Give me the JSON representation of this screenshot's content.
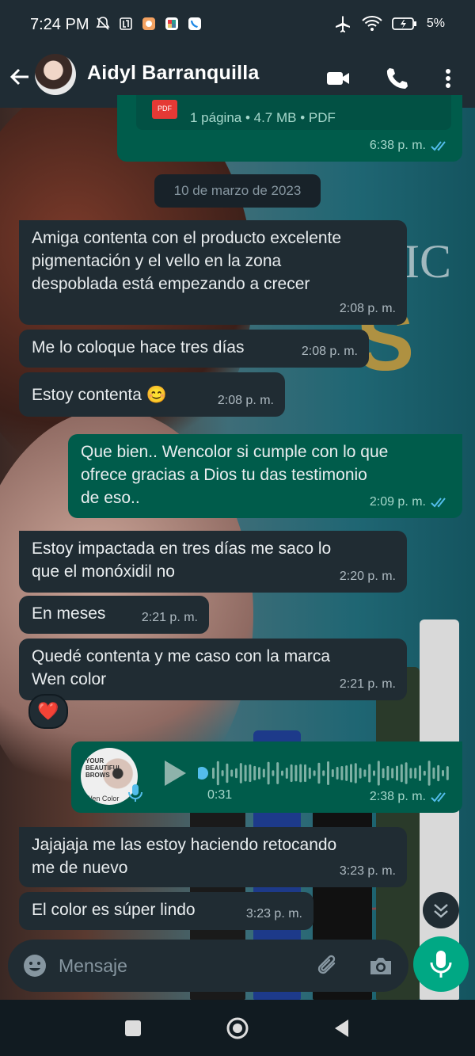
{
  "status_bar": {
    "time": "7:24 PM",
    "battery": "5%"
  },
  "header": {
    "contact_name": "Aidyl Barranquilla"
  },
  "pdf_message": {
    "info": "1 página • 4.7 MB • PDF",
    "time": "6:38 p. m."
  },
  "date_chip": "10 de marzo de 2023",
  "messages": [
    {
      "lines": [
        "Amiga contenta con el producto excelente",
        "pigmentación y el vello en la zona",
        "despoblada está empezando a crecer"
      ],
      "time": "2:08 p. m."
    },
    {
      "lines": [
        "Me lo coloque hace tres días"
      ],
      "time": "2:08 p. m."
    },
    {
      "lines": [
        "Estoy contenta 😊"
      ],
      "time": "2:08 p. m."
    },
    {
      "lines": [
        "Que bien.. Wencolor si cumple con lo que",
        "ofrece gracias a Dios tu das testimonio",
        "de eso.."
      ],
      "time": "2:09 p. m."
    },
    {
      "lines": [
        "Estoy impactada en tres días me saco lo",
        "que el monóxidil no"
      ],
      "time": "2:20 p. m."
    },
    {
      "lines": [
        "En meses"
      ],
      "time": "2:21 p. m."
    },
    {
      "lines": [
        "Quedé contenta y me caso con la marca",
        "Wen color"
      ],
      "time": "2:21 p. m."
    },
    {
      "lines": [
        "Jajajaja me las estoy haciendo retocando",
        "me de nuevo"
      ],
      "time": "3:23 p. m."
    },
    {
      "lines": [
        "El color es súper lindo"
      ],
      "time": "3:23 p. m."
    }
  ],
  "reaction": "❤️",
  "voice_note": {
    "duration": "0:31",
    "time": "2:38 p. m."
  },
  "composer": {
    "placeholder": "Mensaje"
  },
  "colors": {
    "incoming": "#202c33",
    "outgoing": "#005c4b",
    "accent": "#00a884",
    "read_ticks": "#53bdeb"
  }
}
